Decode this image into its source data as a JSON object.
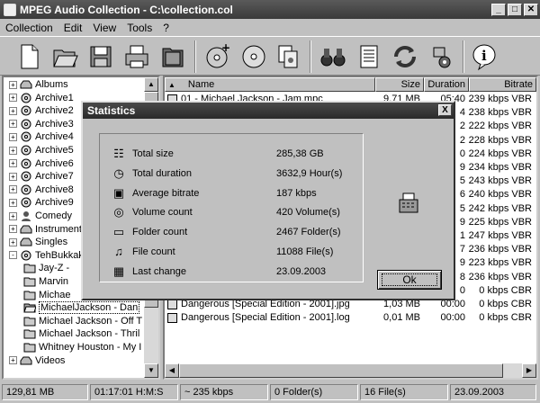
{
  "window": {
    "title": "MPEG Audio Collection - C:\\collection.col"
  },
  "menu": [
    "Collection",
    "Edit",
    "View",
    "Tools",
    "?"
  ],
  "toolbar_icons": [
    "new-file-icon",
    "open-folder-icon",
    "save-icon",
    "print-icon",
    "folder-icon",
    "add-cd-icon",
    "cd-icon",
    "copy-icon",
    "binoculars-icon",
    "list-icon",
    "refresh-icon",
    "settings-icon",
    "info-icon"
  ],
  "tree": [
    {
      "label": "Albums",
      "indent": 0,
      "exp": "+",
      "icon": "drive"
    },
    {
      "label": "Archive1",
      "indent": 0,
      "exp": "+",
      "icon": "cd"
    },
    {
      "label": "Archive2",
      "indent": 0,
      "exp": "+",
      "icon": "cd"
    },
    {
      "label": "Archive3",
      "indent": 0,
      "exp": "+",
      "icon": "cd"
    },
    {
      "label": "Archive4",
      "indent": 0,
      "exp": "+",
      "icon": "cd"
    },
    {
      "label": "Archive5",
      "indent": 0,
      "exp": "+",
      "icon": "cd"
    },
    {
      "label": "Archive6",
      "indent": 0,
      "exp": "+",
      "icon": "cd"
    },
    {
      "label": "Archive7",
      "indent": 0,
      "exp": "+",
      "icon": "cd"
    },
    {
      "label": "Archive8",
      "indent": 0,
      "exp": "+",
      "icon": "cd"
    },
    {
      "label": "Archive9",
      "indent": 0,
      "exp": "+",
      "icon": "cd"
    },
    {
      "label": "Comedy",
      "indent": 0,
      "exp": "+",
      "icon": "user"
    },
    {
      "label": "Instrumenta",
      "indent": 0,
      "exp": "+",
      "icon": "drive"
    },
    {
      "label": "Singles",
      "indent": 0,
      "exp": "+",
      "icon": "drive"
    },
    {
      "label": "TehBukkak",
      "indent": 0,
      "exp": "-",
      "icon": "cd"
    },
    {
      "label": "Jay-Z -",
      "indent": 1,
      "exp": "",
      "icon": "folder"
    },
    {
      "label": "Marvin",
      "indent": 1,
      "exp": "",
      "icon": "folder"
    },
    {
      "label": "Michae",
      "indent": 1,
      "exp": "",
      "icon": "folder"
    },
    {
      "label": "MichaelJackson - Dan",
      "indent": 1,
      "exp": "",
      "icon": "folder-open",
      "selected": true
    },
    {
      "label": "Michael Jackson - Off T",
      "indent": 1,
      "exp": "",
      "icon": "folder"
    },
    {
      "label": "Michael Jackson - Thril",
      "indent": 1,
      "exp": "",
      "icon": "folder"
    },
    {
      "label": "Whitney Houston - My I",
      "indent": 1,
      "exp": "",
      "icon": "folder"
    },
    {
      "label": "Videos",
      "indent": 0,
      "exp": "+",
      "icon": "drive"
    }
  ],
  "list": {
    "headers": {
      "name": "Name",
      "size": "Size",
      "duration": "Duration",
      "bitrate": "Bitrate"
    },
    "rows": [
      {
        "name": "01 - Michael Jackson - Jam.mpc",
        "size": "9,71 MB",
        "duration": "05:40",
        "bitrate": "239 kbps VBR"
      },
      {
        "name": "",
        "size": "",
        "duration": "4",
        "bitrate": "238 kbps VBR"
      },
      {
        "name": "",
        "size": "",
        "duration": "2",
        "bitrate": "222 kbps VBR"
      },
      {
        "name": "",
        "size": "",
        "duration": "2",
        "bitrate": "228 kbps VBR"
      },
      {
        "name": "",
        "size": "",
        "duration": "0",
        "bitrate": "224 kbps VBR"
      },
      {
        "name": "",
        "size": "",
        "duration": "9",
        "bitrate": "234 kbps VBR"
      },
      {
        "name": "",
        "size": "",
        "duration": "5",
        "bitrate": "243 kbps VBR"
      },
      {
        "name": "",
        "size": "",
        "duration": "6",
        "bitrate": "240 kbps VBR"
      },
      {
        "name": "",
        "size": "",
        "duration": "5",
        "bitrate": "242 kbps VBR"
      },
      {
        "name": "",
        "size": "",
        "duration": "9",
        "bitrate": "225 kbps VBR"
      },
      {
        "name": "",
        "size": "",
        "duration": "1",
        "bitrate": "247 kbps VBR"
      },
      {
        "name": "",
        "size": "",
        "duration": "7",
        "bitrate": "236 kbps VBR"
      },
      {
        "name": "",
        "size": "",
        "duration": "9",
        "bitrate": "223 kbps VBR"
      },
      {
        "name": "",
        "size": "",
        "duration": "8",
        "bitrate": "236 kbps VBR"
      },
      {
        "name": "",
        "size": "",
        "duration": "0",
        "bitrate": "0 kbps CBR"
      },
      {
        "name": "Dangerous [Special Edition - 2001].jpg",
        "size": "1,03 MB",
        "duration": "00:00",
        "bitrate": "0 kbps CBR"
      },
      {
        "name": "Dangerous [Special Edition - 2001].log",
        "size": "0,01 MB",
        "duration": "00:00",
        "bitrate": "0 kbps CBR"
      }
    ]
  },
  "dialog": {
    "title": "Statistics",
    "close": "X",
    "ok": "Ok",
    "stats": [
      {
        "label": "Total size",
        "value": "285,38 GB",
        "icon": "stack-icon"
      },
      {
        "label": "Total duration",
        "value": "3632,9 Hour(s)",
        "icon": "clock-icon"
      },
      {
        "label": "Average bitrate",
        "value": "187 kbps",
        "icon": "monitor-icon"
      },
      {
        "label": "Volume count",
        "value": "420 Volume(s)",
        "icon": "discs-icon"
      },
      {
        "label": "Folder count",
        "value": "2467 Folder(s)",
        "icon": "folder-icon"
      },
      {
        "label": "File count",
        "value": "11088 File(s)",
        "icon": "music-note-icon"
      },
      {
        "label": "Last change",
        "value": "23.09.2003",
        "icon": "calendar-icon"
      }
    ]
  },
  "status": [
    "129,81 MB",
    "01:17:01 H:M:S",
    "~ 235 kbps",
    "0 Folder(s)",
    "16 File(s)",
    "23.09.2003"
  ]
}
